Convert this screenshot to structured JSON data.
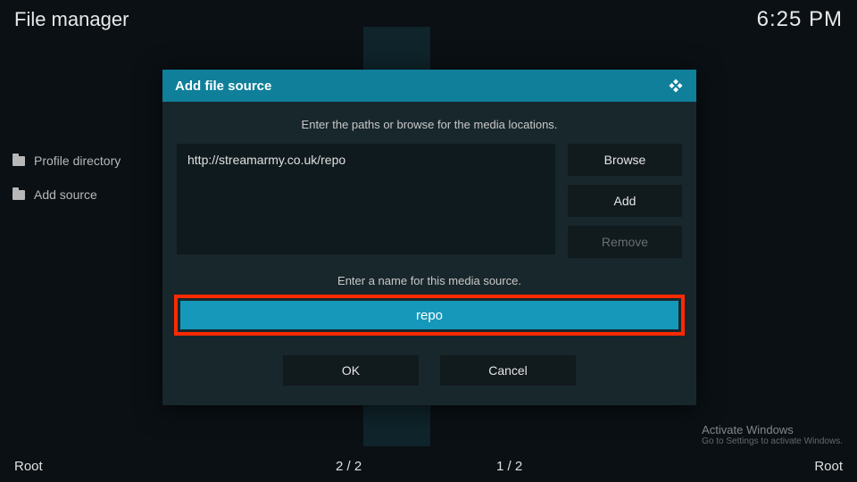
{
  "header": {
    "app_title": "File manager",
    "clock": "6:25 PM"
  },
  "sidebar": {
    "items": [
      {
        "label": "Profile directory"
      },
      {
        "label": "Add source"
      }
    ]
  },
  "dialog": {
    "title": "Add file source",
    "prompt": "Enter the paths or browse for the media locations.",
    "path_value": "http://streamarmy.co.uk/repo",
    "browse_label": "Browse",
    "add_label": "Add",
    "remove_label": "Remove",
    "name_prompt": "Enter a name for this media source.",
    "name_value": "repo",
    "ok_label": "OK",
    "cancel_label": "Cancel"
  },
  "watermark": {
    "line1": "Activate Windows",
    "line2": "Go to Settings to activate Windows."
  },
  "footer": {
    "left": "Root",
    "counter_left": "2 / 2",
    "counter_right": "1 / 2",
    "right": "Root"
  }
}
